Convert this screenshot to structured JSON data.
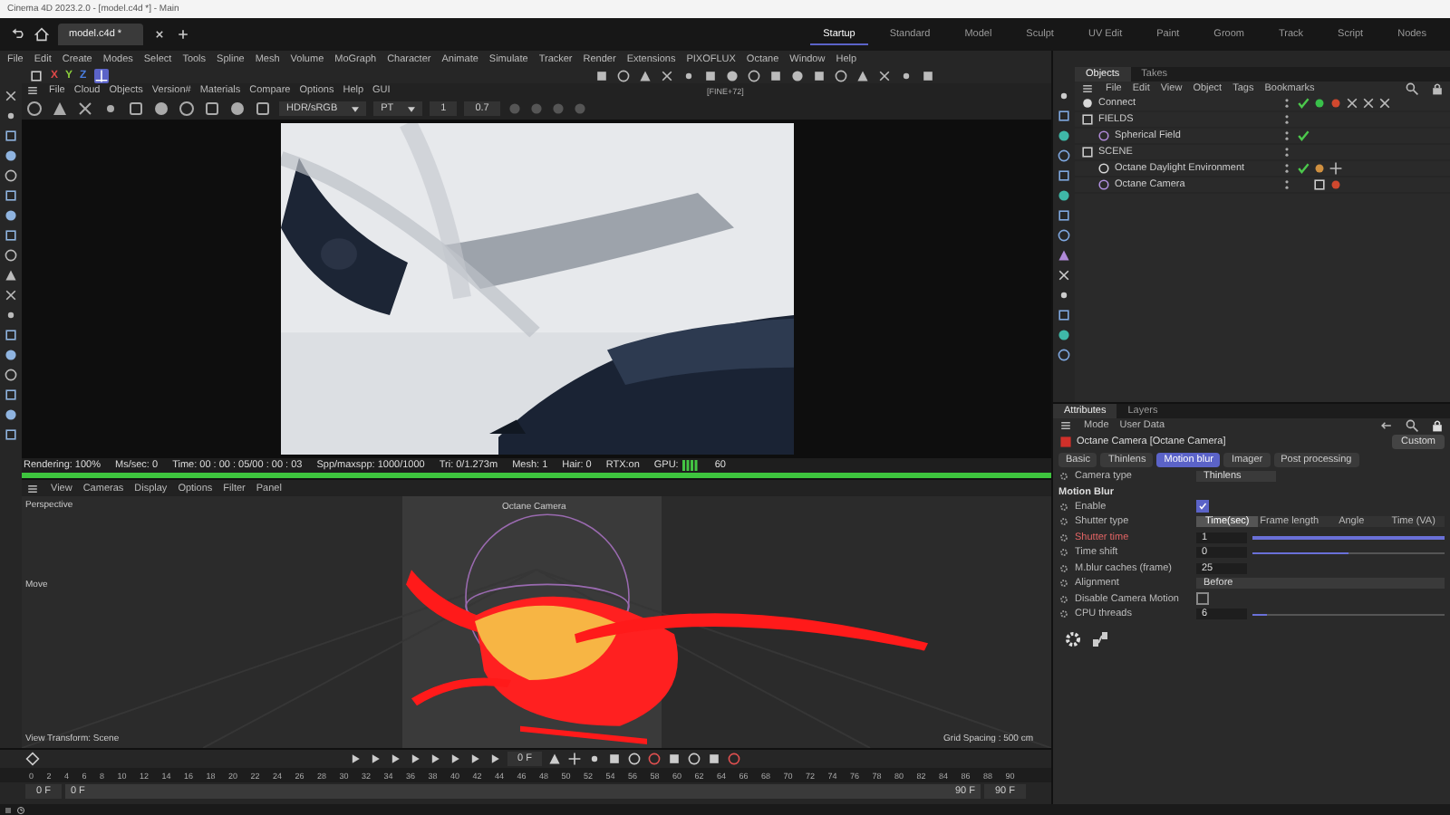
{
  "window": {
    "title": "Cinema 4D 2023.2.0 - [model.c4d *] - Main"
  },
  "document_tabs": [
    {
      "label": "model.c4d *",
      "selected": true
    }
  ],
  "layouts": [
    {
      "label": "Startup",
      "selected": true
    },
    {
      "label": "Standard",
      "selected": false
    },
    {
      "label": "Model",
      "selected": false
    },
    {
      "label": "Sculpt",
      "selected": false
    },
    {
      "label": "UV Edit",
      "selected": false
    },
    {
      "label": "Paint",
      "selected": false
    },
    {
      "label": "Groom",
      "selected": false
    },
    {
      "label": "Track",
      "selected": false
    },
    {
      "label": "Script",
      "selected": false
    },
    {
      "label": "Nodes",
      "selected": false
    }
  ],
  "menu": [
    "File",
    "Edit",
    "Create",
    "Modes",
    "Select",
    "Tools",
    "Spline",
    "Mesh",
    "Volume",
    "MoGraph",
    "Character",
    "Animate",
    "Simulate",
    "Tracker",
    "Render",
    "Extensions",
    "PIXOFLUX",
    "Octane",
    "Window",
    "Help"
  ],
  "axis_lock": [
    {
      "label": "X",
      "color": "#e04848"
    },
    {
      "label": "Y",
      "color": "#8ccf3c"
    },
    {
      "label": "Z",
      "color": "#4a7ee0"
    }
  ],
  "render_view": {
    "menu": [
      "File",
      "Cloud",
      "Objects",
      "Version#",
      "Materials",
      "Compare",
      "Options",
      "Help",
      "GUI"
    ],
    "display_mode": "HDR/sRGB",
    "kernel": "PT",
    "field_1": "1",
    "field_2": "0.7",
    "label": "[FINE+72]",
    "status": [
      "Rendering: 100%",
      "Ms/sec: 0",
      "Time: 00 : 00 : 05/00 : 00 : 03",
      "Spp/maxspp: 1000/1000",
      "Tri: 0/1.273m",
      "Mesh: 1",
      "Hair: 0",
      "RTX:on",
      "GPU:",
      "60"
    ],
    "progress": {
      "level": 1
    }
  },
  "viewport": {
    "menu": [
      "View",
      "Cameras",
      "Display",
      "Options",
      "Filter",
      "Panel"
    ],
    "camera": "Perspective",
    "camera_object": "Octane Camera",
    "tool": "Move",
    "view_transform": "View Transform: Scene",
    "grid_spacing": "Grid Spacing : 500 cm"
  },
  "timeline": {
    "ticks": [
      "0",
      "2",
      "4",
      "6",
      "8",
      "10",
      "12",
      "14",
      "16",
      "18",
      "20",
      "22",
      "24",
      "26",
      "28",
      "30",
      "32",
      "34",
      "36",
      "38",
      "40",
      "42",
      "44",
      "46",
      "48",
      "50",
      "52",
      "54",
      "56",
      "58",
      "60",
      "62",
      "64",
      "66",
      "68",
      "70",
      "72",
      "74",
      "76",
      "78",
      "80",
      "82",
      "84",
      "86",
      "88",
      "90"
    ],
    "current_frame": "0 F",
    "start": "0 F",
    "preview_start": "0 F",
    "preview_end": "90 F",
    "end": "90 F"
  },
  "objects_panel": {
    "tabs": [
      {
        "label": "Objects",
        "selected": true
      },
      {
        "label": "Takes",
        "selected": false
      }
    ],
    "menu": [
      "File",
      "Edit",
      "View",
      "Object",
      "Tags",
      "Bookmarks"
    ],
    "tree": [
      {
        "name": "Connect",
        "kind": "connect",
        "checked": true
      },
      {
        "name": "FIELDS",
        "kind": "null",
        "checked": false,
        "children": [
          {
            "name": "Spherical Field",
            "kind": "field",
            "checked": true
          }
        ]
      },
      {
        "name": "SCENE",
        "kind": "null",
        "checked": false,
        "children": [
          {
            "name": "Octane Daylight Environment",
            "kind": "environment",
            "checked": true
          },
          {
            "name": "Octane Camera",
            "kind": "camera",
            "checked": false
          }
        ]
      }
    ]
  },
  "attributes": {
    "tabs": [
      {
        "label": "Attributes",
        "selected": true
      },
      {
        "label": "Layers",
        "selected": false
      }
    ],
    "menu": [
      "Mode",
      "User Data"
    ],
    "object": "Octane Camera [Octane Camera]",
    "preset": "Custom",
    "sub_tabs": [
      {
        "label": "Basic",
        "selected": false
      },
      {
        "label": "Thinlens",
        "selected": false
      },
      {
        "label": "Motion blur",
        "selected": true
      },
      {
        "label": "Imager",
        "selected": false
      },
      {
        "label": "Post processing",
        "selected": false
      }
    ],
    "camera_type": {
      "label": "Camera type",
      "value": "Thinlens"
    },
    "section": "Motion Blur",
    "rows": [
      {
        "kind": "checkbox",
        "label": "Enable",
        "checked": true
      },
      {
        "kind": "segments",
        "label": "Shutter type",
        "options": [
          {
            "label": "Time(sec)",
            "selected": true
          },
          {
            "label": "Frame length",
            "selected": false
          },
          {
            "label": "Angle",
            "selected": false
          },
          {
            "label": "Time (VA)",
            "selected": false
          }
        ]
      },
      {
        "kind": "slider",
        "label": "Shutter time",
        "value": "1",
        "level": 1,
        "highlight": true
      },
      {
        "kind": "slider",
        "label": "Time shift",
        "value": "0",
        "level": 0.5,
        "highlight": false
      },
      {
        "kind": "number",
        "label": "M.blur caches (frame)",
        "value": "25"
      },
      {
        "kind": "dropdown",
        "label": "Alignment",
        "value": "Before"
      },
      {
        "kind": "checkbox",
        "label": "Disable Camera Motion",
        "checked": false
      },
      {
        "kind": "slider",
        "label": "CPU threads",
        "value": "6",
        "level": 0.08,
        "highlight": false
      }
    ]
  }
}
